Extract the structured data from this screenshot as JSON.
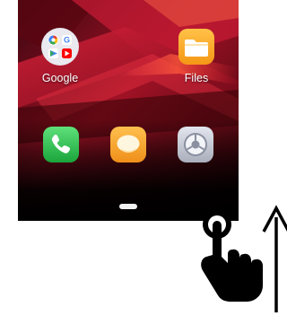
{
  "home_screen": {
    "apps": [
      {
        "label": "Google",
        "icon": "google-folder-icon"
      },
      {
        "label": "Files",
        "icon": "files-folder-icon"
      }
    ],
    "dock": [
      {
        "icon": "phone-icon"
      },
      {
        "icon": "messages-icon"
      },
      {
        "icon": "settings-icon"
      }
    ]
  },
  "gesture_hint": {
    "hand_icon": "tap-hand-icon",
    "arrow_icon": "swipe-up-arrow-icon",
    "direction": "up"
  },
  "colors": {
    "wallpaper_red": "#d8203a",
    "phone_green": "#2fc44f",
    "messages_orange": "#f4a328",
    "settings_gray": "#c6cad4",
    "files_orange": "#f7a22a"
  }
}
